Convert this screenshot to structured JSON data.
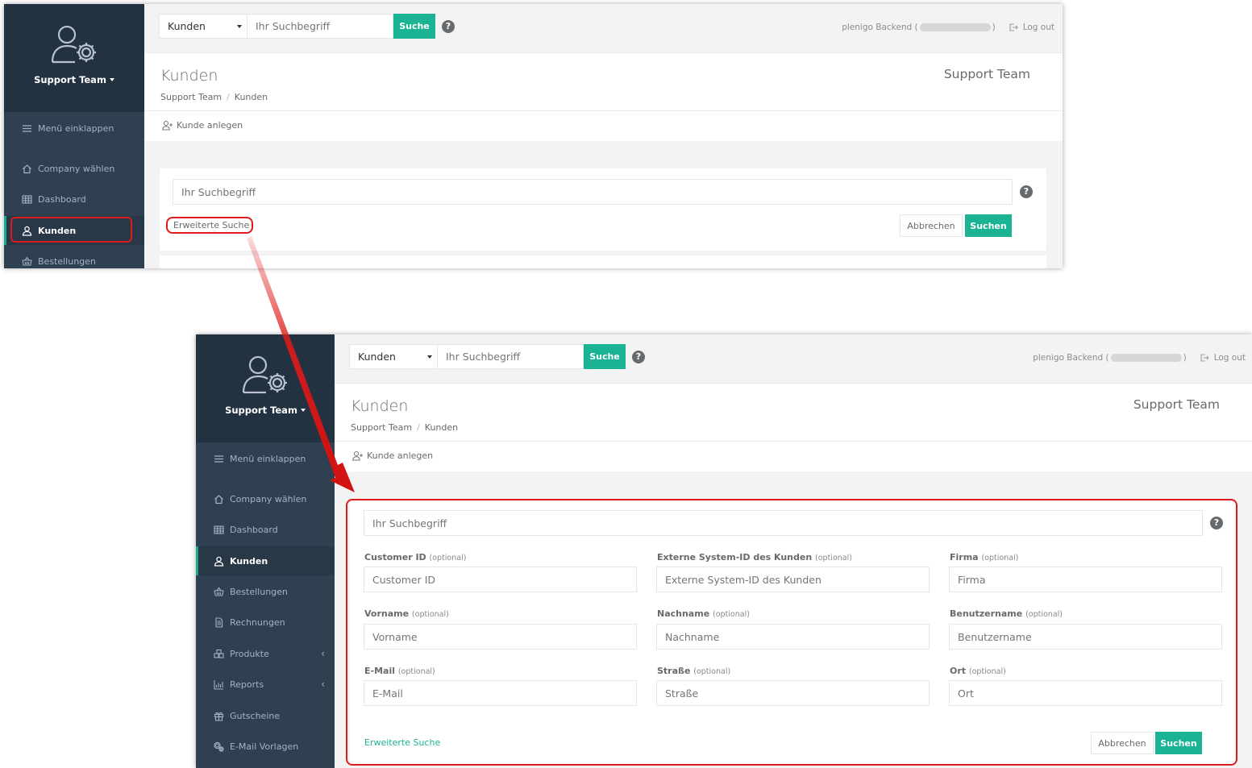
{
  "colors": {
    "accent": "#1ab394",
    "sidebar": "#2f4050",
    "sidebar_header": "#233241",
    "highlight_red": "#e01b1b"
  },
  "sidebar": {
    "team_name": "Support Team",
    "collapse_label": "Menü einklappen",
    "items": [
      {
        "label": "Company wählen",
        "icon": "home-icon"
      },
      {
        "label": "Dashboard",
        "icon": "grid-icon"
      },
      {
        "label": "Kunden",
        "icon": "user-icon",
        "active": true
      },
      {
        "label": "Bestellungen",
        "icon": "basket-icon"
      },
      {
        "label": "Rechnungen",
        "icon": "document-icon"
      },
      {
        "label": "Produkte",
        "icon": "products-icon",
        "has_submenu": true
      },
      {
        "label": "Reports",
        "icon": "chart-icon",
        "has_submenu": true
      },
      {
        "label": "Gutscheine",
        "icon": "gift-icon"
      },
      {
        "label": "E-Mail Vorlagen",
        "icon": "gears-icon"
      }
    ]
  },
  "topbar": {
    "search_select_value": "Kunden",
    "search_placeholder": "Ihr Suchbegriff",
    "search_button": "Suche",
    "user_prefix": "plenigo Backend (",
    "user_suffix": ")",
    "logout_label": "Log out"
  },
  "page": {
    "title": "Kunden",
    "breadcrumb": [
      "Support Team",
      "Kunden"
    ],
    "team_label": "Support Team",
    "add_customer_label": "Kunde anlegen"
  },
  "search_form": {
    "placeholder": "Ihr Suchbegriff",
    "advanced_label": "Erweiterte Suche",
    "cancel_label": "Abbrechen",
    "submit_label": "Suchen",
    "optional_suffix": "(optional)",
    "fields": [
      {
        "label": "Customer ID",
        "placeholder": "Customer ID"
      },
      {
        "label": "Externe System-ID des Kunden",
        "placeholder": "Externe System-ID des Kunden"
      },
      {
        "label": "Firma",
        "placeholder": "Firma"
      },
      {
        "label": "Vorname",
        "placeholder": "Vorname"
      },
      {
        "label": "Nachname",
        "placeholder": "Nachname"
      },
      {
        "label": "Benutzername",
        "placeholder": "Benutzername"
      },
      {
        "label": "E-Mail",
        "placeholder": "E-Mail"
      },
      {
        "label": "Straße",
        "placeholder": "Straße"
      },
      {
        "label": "Ort",
        "placeholder": "Ort"
      }
    ]
  }
}
